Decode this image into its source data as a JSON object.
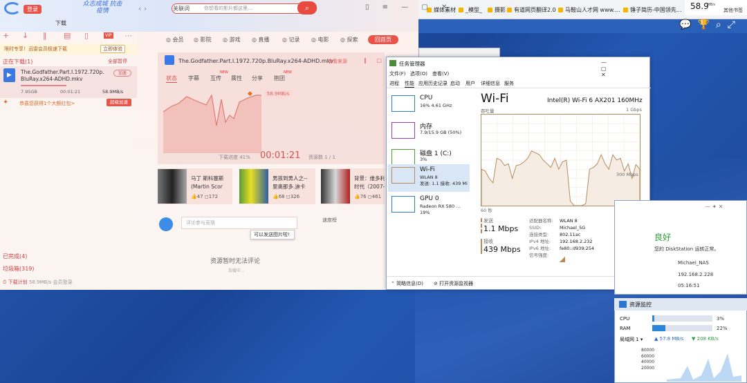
{
  "browser": {
    "bookmarks": [
      "媒体素材",
      "_模型_",
      "摄影",
      "有道网页翻译2.0",
      "马鞍山人才网 www....",
      "锤子简历-中国领先..."
    ],
    "topright_speed": "58.9",
    "topright_unit": "MB/s",
    "other_bookmarks": "其他书签"
  },
  "xunlei": {
    "login": "登录",
    "slogan": "众志成城 抗击疫情",
    "search_category": "关联词",
    "search_placeholder": "你想看的影片都这里...",
    "header_title": "下载",
    "promo_text": "限时专享！迅雷会员极速下载",
    "promo_button": "立即体验",
    "downloading": "正在下载(1)",
    "start_all": "全部暂停",
    "task": {
      "name": "The.Godfather.Part.I.1972.720p.BluRay.x264-ADHD.mkv",
      "accel": "加速",
      "size": "7.95GB",
      "elapsed": "00:01:21",
      "speed": "58.9MB/s",
      "progress": 0.41
    },
    "gift_text": "恭喜您获得1个大额红包>",
    "gift_button": "超级加速",
    "completed": "已完成(4)",
    "trash": "垃圾箱(319)",
    "plan": "下载计划",
    "plan_speed": "58.9MB/s 会员登录",
    "categories": [
      "会员",
      "影院",
      "游戏",
      "直播",
      "记录",
      "电影",
      "探索"
    ],
    "home_button": "回首页",
    "panel_title": "The.Godfather.Part.I.1972.720p.BluRay.x264-ADHD.mkv",
    "panel_more": "查看来源",
    "detail_tabs": [
      "状态",
      "字幕",
      "互传",
      "属性",
      "分享",
      "抱团"
    ],
    "new_badge": "NEW",
    "speed_tag": "58.9MB/s",
    "progress_text": "下载进度 41%",
    "timer": "00:01:21",
    "resources": "资源数 1 / 1",
    "recommendations": [
      {
        "title": "马丁 斯科塞斯",
        "subtitle": "(Martin Scor",
        "likes": "47",
        "comments": "172"
      },
      {
        "title": "男孩到男人之--",
        "subtitle": "里奥那多.迪卡",
        "likes": "68",
        "comments": "326"
      },
      {
        "title": "背景：维多利",
        "subtitle": "时代（2007--",
        "likes": "76",
        "comments": "461"
      }
    ],
    "comment_placeholder": "评论参与竞猜",
    "speed_label": "速度榜",
    "tooltip": "可以发送图片啦!",
    "no_comment": "资源暂时无法评论",
    "loading": "加载中..."
  },
  "taskmgr": {
    "title": "任务管理器",
    "menu": [
      "文件(F)",
      "选项(O)",
      "查看(V)"
    ],
    "tabs": [
      "进程",
      "性能",
      "应用历史记录",
      "启动",
      "用户",
      "详细信息",
      "服务"
    ],
    "sidebar": [
      {
        "name": "CPU",
        "sub": "16% 4.61 GHz",
        "color": "#2a7fd4"
      },
      {
        "name": "内存",
        "sub": "7.9/15.9 GB (50%)",
        "color": "#9a3fb0"
      },
      {
        "name": "磁盘 1 (C:)",
        "sub": "3%",
        "color": "#4aa02c"
      },
      {
        "name": "Wi-Fi",
        "sub": "WLAN 8",
        "sub2": "发送: 1.1 接收: 439 Mi",
        "color": "#b48a5a"
      },
      {
        "name": "GPU 0",
        "sub": "Radeon RX 580 ...",
        "sub2": "19%",
        "color": "#2a7fd4"
      }
    ],
    "heading": "Wi-Fi",
    "adapter": "Intel(R) Wi-Fi 6 AX201 160MHz",
    "throughput": "吞吐量",
    "max": "1 Gbps",
    "mid": "300 Mbps",
    "axis_left": "60 秒",
    "axis_right": "0",
    "send_label": "发送",
    "send_value": "1.1 Mbps",
    "recv_label": "接收",
    "recv_value": "439 Mbps",
    "props": [
      {
        "k": "适配器名称:",
        "v": "WLAN 8"
      },
      {
        "k": "SSID:",
        "v": "Michael_5G"
      },
      {
        "k": "连接类型:",
        "v": "802.11ac"
      },
      {
        "k": "IPv4 地址:",
        "v": "192.168.2.232"
      },
      {
        "k": "IPv6 地址:",
        "v": "fe80::d939:254"
      },
      {
        "k": "信号强度:",
        "v": ""
      }
    ],
    "footer_brief": "简略信息(D)",
    "footer_monitor": "打开资源监视器",
    "graph_points": [
      60,
      62,
      70,
      75,
      48,
      50,
      56,
      54,
      70,
      56,
      55,
      52,
      48,
      40,
      42,
      44,
      50,
      54,
      58,
      48,
      60,
      52,
      50,
      95,
      100,
      100,
      100,
      98,
      60,
      58,
      54,
      44,
      54,
      60,
      44,
      50,
      48,
      62,
      54,
      70,
      55,
      60
    ]
  },
  "synology": {
    "status": "良好",
    "message": "您的 DiskStation 运转正常。",
    "name": "Michael_NAS",
    "ip": "192.168.2.228",
    "time": "05:16:51"
  },
  "resmon": {
    "title": "资源监控",
    "cpu_label": "CPU",
    "cpu_value": "3%",
    "cpu_pct": 3,
    "ram_label": "RAM",
    "ram_value": "22%",
    "ram_pct": 22,
    "lan_label": "局域网 1 ▾",
    "up": "57.8 MB/s",
    "down": "208 KB/s",
    "y_ticks": [
      "80000",
      "60000",
      "40000",
      "20000"
    ]
  }
}
